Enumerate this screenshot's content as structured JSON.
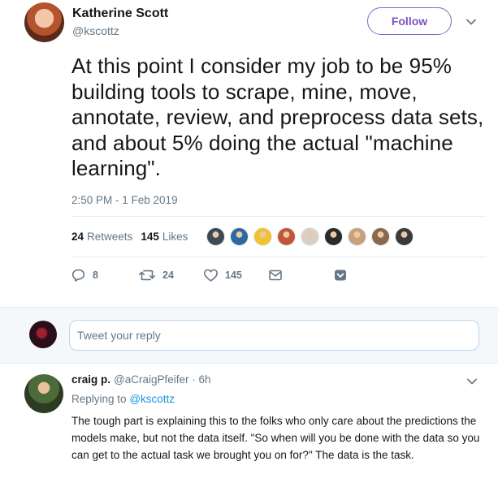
{
  "tweet": {
    "author_name": "Katherine Scott",
    "author_handle": "@kscottz",
    "follow_label": "Follow",
    "text": "At this point I consider my job to be 95% building tools to scrape, mine, move, annotate, review, and preprocess data sets, and about 5% doing the actual \"machine learning\".",
    "timestamp": "2:50 PM - 1 Feb 2019",
    "retweets_count": "24",
    "retweets_label": "Retweets",
    "likes_count": "145",
    "likes_label": "Likes",
    "liker_colors": [
      "#3d4a55",
      "#2c6aa0",
      "#f2c230",
      "#c0553a",
      "#d8d0c4",
      "#2a2a2a",
      "#c9a27a",
      "#8a6a4a",
      "#3a3a3a"
    ],
    "actions": {
      "reply_count": "8",
      "retweet_count": "24",
      "like_count": "145"
    }
  },
  "reply_box": {
    "placeholder": "Tweet your reply"
  },
  "reply": {
    "author_name": "craig p.",
    "meta": "@aCraigPfeifer · 6h",
    "replying_prefix": "Replying to",
    "replying_handle": "@kscottz",
    "text": "The tough part is explaining this to the folks who only care about the predictions the models make, but not the data itself. \"So when will you be done with the data so you can get to the actual task we brought you on for?\" The data is the task."
  },
  "colors": {
    "accent_purple": "#7a52c0",
    "link_blue": "#1b95e0",
    "muted": "#657786"
  }
}
